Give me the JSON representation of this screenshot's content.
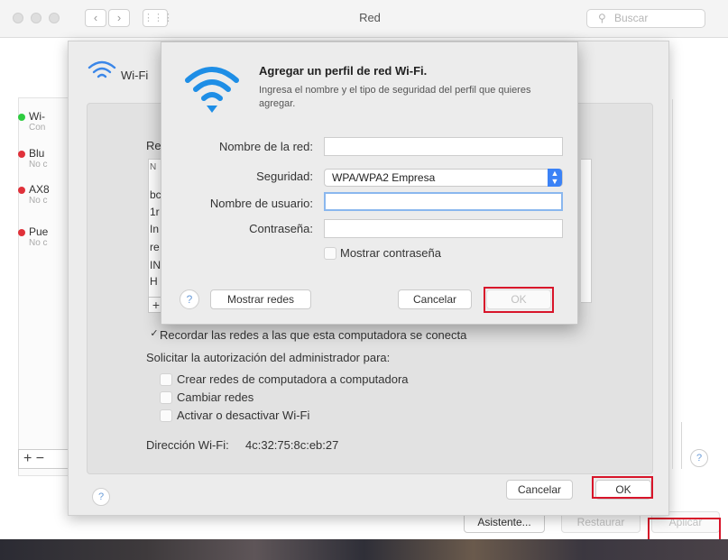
{
  "window": {
    "title": "Red",
    "search_placeholder": "Buscar"
  },
  "sidebar": {
    "items": [
      {
        "name": "Wi-",
        "status": "Con",
        "color": "#2ecc40"
      },
      {
        "name": "Blu",
        "status": "No c",
        "color": "#e0313a"
      },
      {
        "name": "AX8",
        "status": "No c",
        "color": "#e0313a"
      },
      {
        "name": "Pue",
        "status": "No c",
        "color": "#e0313a"
      }
    ]
  },
  "advanced": {
    "wifi_label": "Wi-Fi",
    "list_header_partial": "Re",
    "list_letters": [
      "N",
      "bc",
      "1r",
      "In",
      "re",
      "IN",
      "H"
    ],
    "remember_label": "Recordar las redes a las que esta computadora se conecta",
    "admin_label": "Solicitar la autorización del administrador para:",
    "options": [
      "Crear redes de computadora a computadora",
      "Cambiar redes",
      "Activar o desactivar Wi-Fi"
    ],
    "wifi_address_label": "Dirección Wi-Fi:",
    "wifi_address_value": "4c:32:75:8c:eb:27",
    "cancel": "Cancelar",
    "ok": "OK"
  },
  "dialog": {
    "title": "Agregar un perfil de red Wi-Fi.",
    "description": "Ingresa el nombre y el tipo de seguridad del perfil que quieres agregar.",
    "network_name_label": "Nombre de la red:",
    "security_label": "Seguridad:",
    "security_value": "WPA/WPA2 Empresa",
    "username_label": "Nombre de usuario:",
    "password_label": "Contraseña:",
    "show_password_label": "Mostrar contraseña",
    "show_networks": "Mostrar redes",
    "cancel": "Cancelar",
    "ok": "OK"
  },
  "bottom": {
    "assistant": "Asistente...",
    "restore": "Restaurar",
    "apply": "Aplicar"
  },
  "colors": {
    "accent": "#3b82f6",
    "highlight": "#d8152a"
  }
}
